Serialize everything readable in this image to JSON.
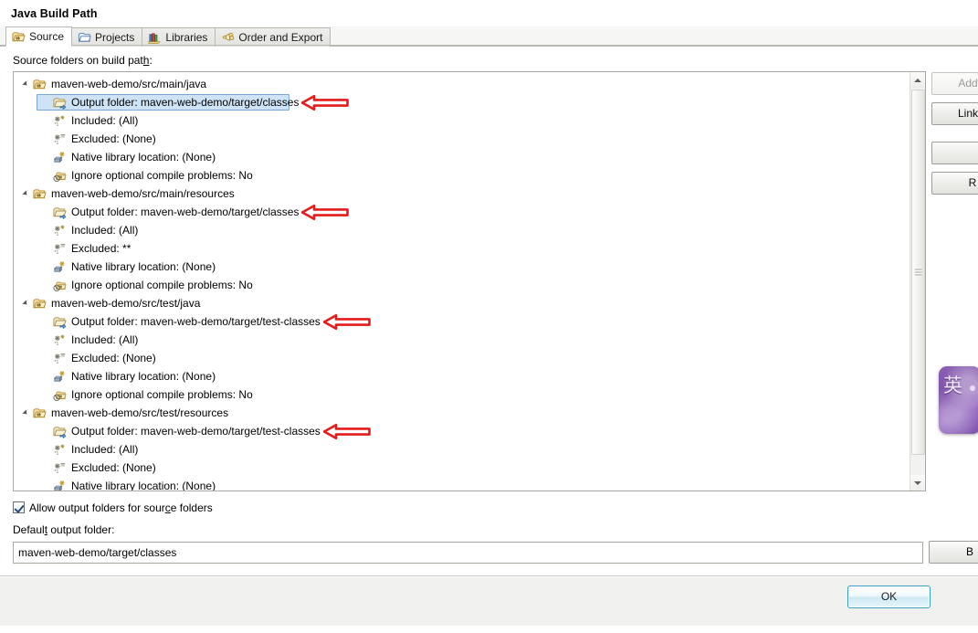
{
  "dialog": {
    "title": "Java Build Path"
  },
  "tabs": [
    {
      "label": "Source",
      "icon": "source-folder-icon",
      "selected": true
    },
    {
      "label": "Projects",
      "icon": "projects-icon",
      "selected": false
    },
    {
      "label": "Libraries",
      "icon": "libraries-icon",
      "selected": false
    },
    {
      "label": "Order and Export",
      "icon": "order-export-icon",
      "selected": false
    }
  ],
  "tree": {
    "section_label_pre": "Source folders on build pat",
    "section_label_mnemonic": "h",
    "section_label_post": ":",
    "groups": [
      {
        "label": "maven-web-demo/src/main/java",
        "icon": "source-folder-icon",
        "children": [
          {
            "label": "Output folder: maven-web-demo/target/classes",
            "icon": "output-folder-icon",
            "selected": true,
            "annotated": true
          },
          {
            "label": "Included: (All)",
            "icon": "included-icon",
            "selected": false,
            "annotated": false
          },
          {
            "label": "Excluded: (None)",
            "icon": "excluded-icon",
            "selected": false,
            "annotated": false
          },
          {
            "label": "Native library location: (None)",
            "icon": "native-library-icon",
            "selected": false,
            "annotated": false
          },
          {
            "label": "Ignore optional compile problems: No",
            "icon": "ignore-problems-icon",
            "selected": false,
            "annotated": false
          }
        ]
      },
      {
        "label": "maven-web-demo/src/main/resources",
        "icon": "source-folder-icon",
        "children": [
          {
            "label": "Output folder: maven-web-demo/target/classes",
            "icon": "output-folder-icon",
            "selected": false,
            "annotated": true
          },
          {
            "label": "Included: (All)",
            "icon": "included-icon",
            "selected": false,
            "annotated": false
          },
          {
            "label": "Excluded: **",
            "icon": "excluded-icon",
            "selected": false,
            "annotated": false
          },
          {
            "label": "Native library location: (None)",
            "icon": "native-library-icon",
            "selected": false,
            "annotated": false
          },
          {
            "label": "Ignore optional compile problems: No",
            "icon": "ignore-problems-icon",
            "selected": false,
            "annotated": false
          }
        ]
      },
      {
        "label": "maven-web-demo/src/test/java",
        "icon": "source-folder-icon",
        "children": [
          {
            "label": "Output folder: maven-web-demo/target/test-classes",
            "icon": "output-folder-icon",
            "selected": false,
            "annotated": true
          },
          {
            "label": "Included: (All)",
            "icon": "included-icon",
            "selected": false,
            "annotated": false
          },
          {
            "label": "Excluded: (None)",
            "icon": "excluded-icon",
            "selected": false,
            "annotated": false
          },
          {
            "label": "Native library location: (None)",
            "icon": "native-library-icon",
            "selected": false,
            "annotated": false
          },
          {
            "label": "Ignore optional compile problems: No",
            "icon": "ignore-problems-icon",
            "selected": false,
            "annotated": false
          }
        ]
      },
      {
        "label": "maven-web-demo/src/test/resources",
        "icon": "source-folder-icon",
        "children": [
          {
            "label": "Output folder: maven-web-demo/target/test-classes",
            "icon": "output-folder-icon",
            "selected": false,
            "annotated": true
          },
          {
            "label": "Included: (All)",
            "icon": "included-icon",
            "selected": false,
            "annotated": false
          },
          {
            "label": "Excluded: (None)",
            "icon": "excluded-icon",
            "selected": false,
            "annotated": false
          },
          {
            "label": "Native library location: (None)",
            "icon": "native-library-icon",
            "selected": false,
            "annotated": false
          }
        ]
      }
    ]
  },
  "side_buttons": [
    {
      "label": "Add...",
      "mnemonic": "A",
      "disabled": true,
      "name": "add-folder-button"
    },
    {
      "label": "Link...",
      "mnemonic": "n",
      "disabled": false,
      "name": "link-source-button"
    },
    {
      "label": "",
      "mnemonic": "",
      "disabled": false,
      "name": "edit-button"
    },
    {
      "label": "R",
      "mnemonic": "R",
      "disabled": false,
      "name": "remove-button"
    }
  ],
  "options": {
    "allow_output_folders_pre": "Allow output folders for sour",
    "allow_output_folders_mnemonic": "c",
    "allow_output_folders_post": "e folders",
    "allow_output_folders_checked": true,
    "default_output_label_pre": "Defaul",
    "default_output_label_mnemonic": "t",
    "default_output_label_post": " output folder:",
    "default_output_value": "maven-web-demo/target/classes",
    "browse_label": "B"
  },
  "footer": {
    "ok_label": "OK"
  },
  "ime": {
    "mode_char": "英"
  },
  "colors": {
    "selection_bg": "#cfe3f7",
    "selection_border": "#7aa9d8",
    "annotation_arrow": "#e51b1b",
    "ok_border": "#3c9fc4",
    "ime_purple": "#7c4fa8"
  }
}
